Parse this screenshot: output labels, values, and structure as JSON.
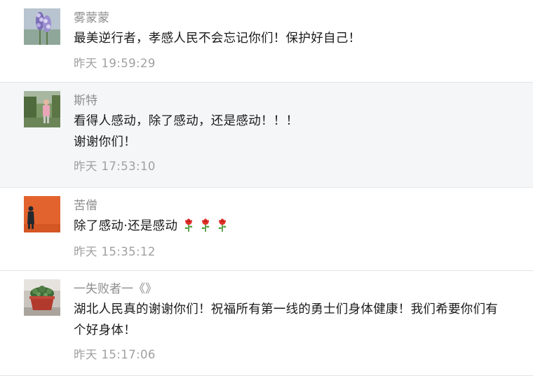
{
  "comments": [
    {
      "nickname": "雾蒙蒙",
      "lines": [
        "最美逆行者，孝感人民不会忘记你们！保护好自己！"
      ],
      "time": "昨天 19:59:29",
      "avatar": "lavender-flower-avatar"
    },
    {
      "nickname": "斯特",
      "lines": [
        "看得人感动，除了感动，还是感动！！！",
        "谢谢你们！"
      ],
      "time": "昨天 17:53:10",
      "avatar": "garden-person-avatar"
    },
    {
      "nickname": "苦僧",
      "lines": [
        "除了感动·还是感动"
      ],
      "emoji": [
        "rose-icon",
        "rose-icon",
        "rose-icon"
      ],
      "time": "昨天 15:35:12",
      "avatar": "orange-wall-person-avatar"
    },
    {
      "nickname": "一失败者一《》",
      "lines": [
        "湖北人民真的谢谢你们！祝福所有第一线的勇士们身体健康！我们希要你们有",
        "个好身体！"
      ],
      "time": "昨天 15:17:06",
      "avatar": "potted-plant-avatar"
    }
  ]
}
